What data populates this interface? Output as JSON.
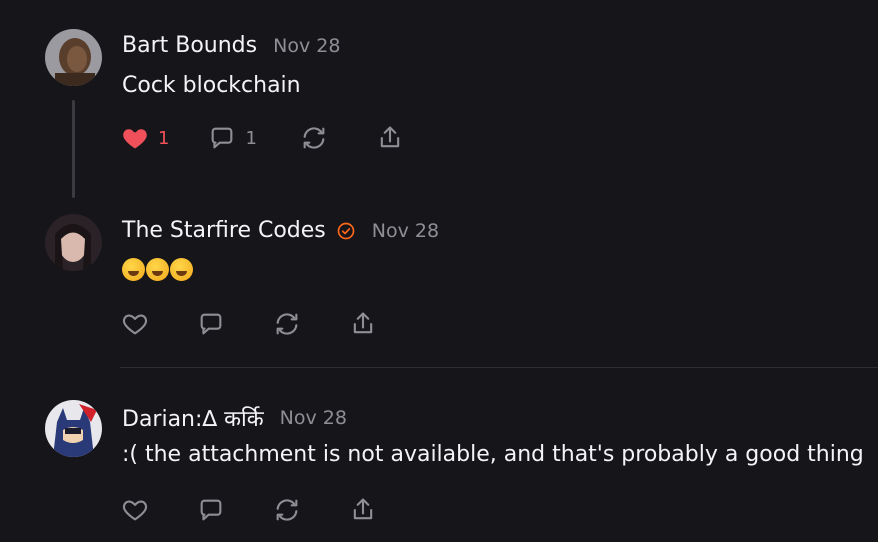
{
  "posts": [
    {
      "author": "Bart Bounds",
      "date": "Nov 28",
      "text": "Cock blockchain",
      "like_count": "1",
      "reply_count": "1",
      "liked": true,
      "avatar_icon": "caveman-avatar"
    },
    {
      "author": "The Starfire Codes",
      "date": "Nov 28",
      "verified": true,
      "text_emojis": [
        "rolling-on-floor-laughing",
        "rolling-on-floor-laughing",
        "rolling-on-floor-laughing"
      ],
      "avatar_icon": "woman-avatar"
    },
    {
      "author": "Darian:∆ कर्कि",
      "date": "Nov 28",
      "text": ":( the attachment is not available, and that's probably a good thing",
      "avatar_icon": "batman-avatar"
    }
  ],
  "colors": {
    "background": "#16161a",
    "like_red": "#f0505a",
    "verified_orange": "#ff6719",
    "muted": "#8e8e95"
  }
}
